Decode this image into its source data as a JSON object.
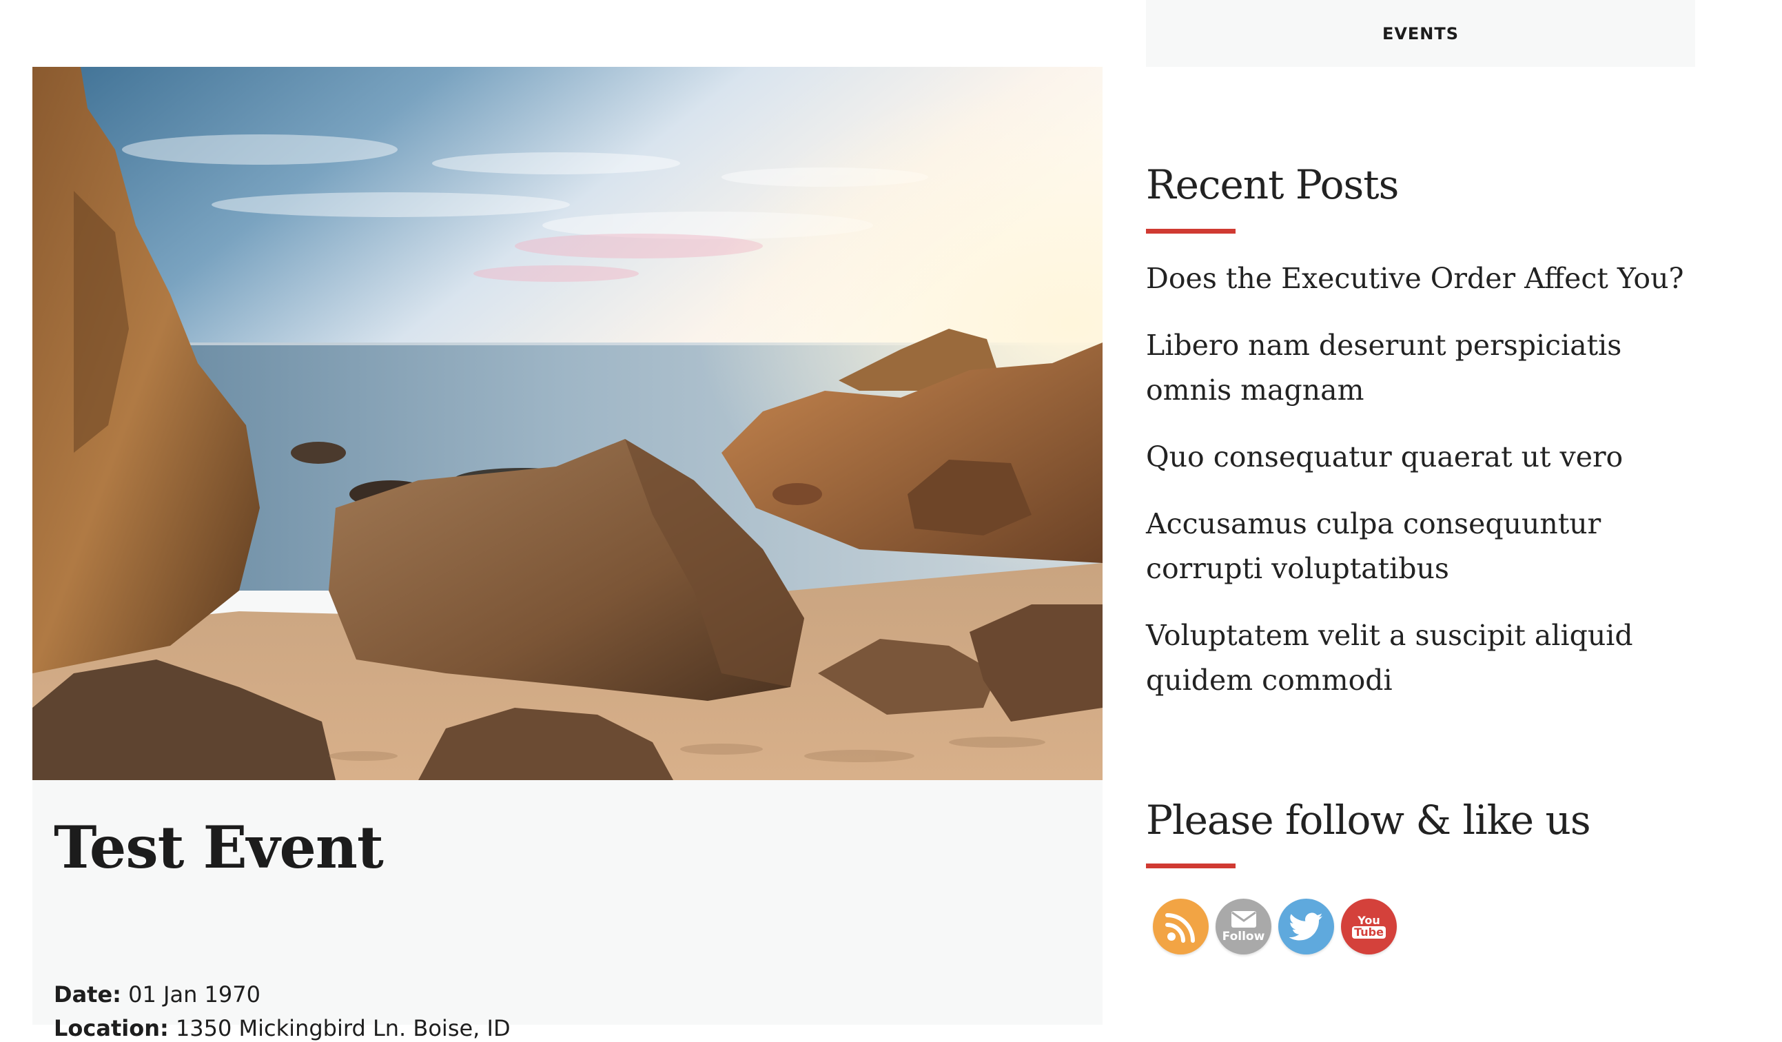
{
  "event": {
    "title": "Test Event",
    "date_label": "Date:",
    "date_value": "01 Jan 1970",
    "location_label": "Location:",
    "location_value": "1350 Mickingbird Ln. Boise, ID"
  },
  "sidebar": {
    "events_tab": "EVENTS",
    "recent_posts": {
      "title": "Recent Posts",
      "items": [
        "Does the Executive Order Affect You?",
        "Libero nam deserunt perspiciatis omnis magnam",
        "Quo consequatur quaerat ut vero",
        "Accusamus culpa consequuntur corrupti voluptatibus",
        "Voluptatem velit a suscipit aliquid quidem commodi"
      ]
    },
    "follow": {
      "title": "Please follow & like us",
      "icons": [
        {
          "name": "rss-icon",
          "color": "#f2a444"
        },
        {
          "name": "email-follow-icon",
          "color": "#a9a9a9",
          "label": "Follow"
        },
        {
          "name": "twitter-icon",
          "color": "#5fa9dd"
        },
        {
          "name": "youtube-icon",
          "color": "#d4413b",
          "label_top": "You",
          "label_bottom": "Tube"
        }
      ]
    }
  },
  "colors": {
    "accent": "#d03a32",
    "panel_bg": "#f7f8f8",
    "text": "#222222"
  }
}
